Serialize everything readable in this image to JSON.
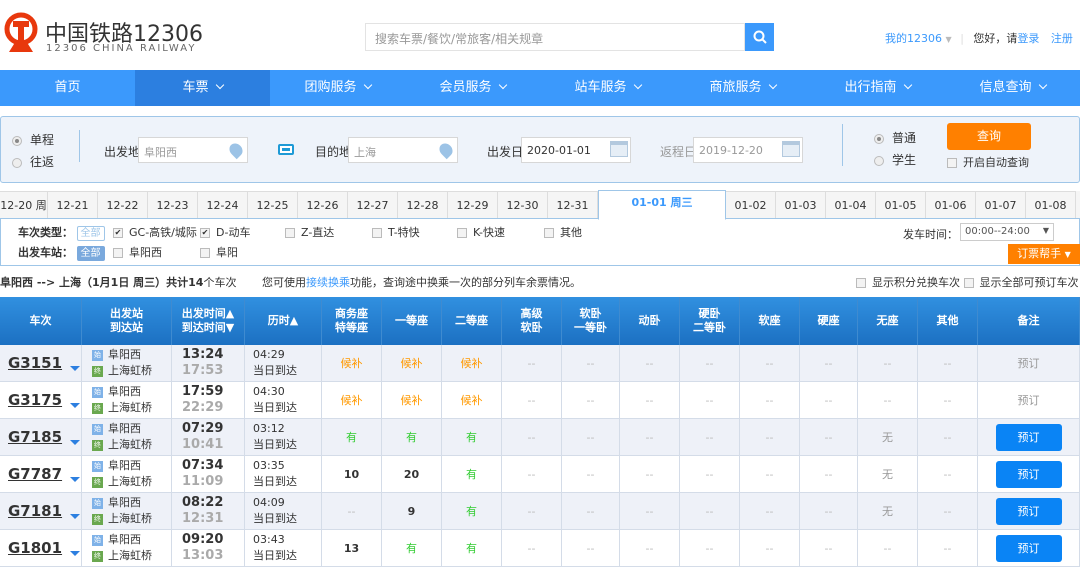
{
  "header": {
    "logo_cn": "中国铁路12306",
    "logo_en": "12306 CHINA RAILWAY",
    "search_placeholder": "搜索车票/餐饮/常旅客/相关规章",
    "my12306": "我的12306",
    "greeting": "您好，请",
    "login": "登录",
    "register": "注册"
  },
  "nav": [
    {
      "label": "首页"
    },
    {
      "label": "车票"
    },
    {
      "label": "团购服务"
    },
    {
      "label": "会员服务"
    },
    {
      "label": "站车服务"
    },
    {
      "label": "商旅服务"
    },
    {
      "label": "出行指南"
    },
    {
      "label": "信息查询"
    }
  ],
  "query": {
    "oneway": "单程",
    "roundtrip": "往返",
    "from_label": "出发地",
    "from_value": "阜阳西",
    "to_label": "目的地",
    "to_value": "上海",
    "date_label": "出发日",
    "date_value": "2020-01-01",
    "return_label": "返程日",
    "return_value": "2019-12-20",
    "normal": "普通",
    "student": "学生",
    "query_btn": "查询",
    "auto_query": "开启自动查询"
  },
  "dates": [
    "12-20 周",
    "12-21",
    "12-22",
    "12-23",
    "12-24",
    "12-25",
    "12-26",
    "12-27",
    "12-28",
    "12-29",
    "12-30",
    "12-31",
    "01-01 周三",
    "01-02",
    "01-03",
    "01-04",
    "01-05",
    "01-06",
    "01-07",
    "01-08"
  ],
  "filters": {
    "type_label": "车次类型：",
    "all": "全部",
    "types": [
      "GC-高铁/城际",
      "D-动车",
      "Z-直达",
      "T-特快",
      "K-快速",
      "其他"
    ],
    "station_label": "出发车站：",
    "stations": [
      "阜阳西",
      "阜阳"
    ],
    "time_label": "发车时间：",
    "time_value": "00:00--24:00",
    "helper": "订票帮手"
  },
  "summary": {
    "route": "阜阳西 --> 上海（1月1日  周三）共计",
    "count": "14",
    "suffix": "个车次",
    "tip_pre": "您可使用",
    "tip_link": "接续换乘",
    "tip_post": "功能，查询途中换乘一次的部分列车余票情况。",
    "opt1": "显示积分兑换车次",
    "opt2": "显示全部可预订车次"
  },
  "columns": [
    "车次",
    "出发站\n到达站",
    "出发时间▲\n到达时间▼",
    "历时▲",
    "商务座\n特等座",
    "一等座",
    "二等座",
    "高级\n软卧",
    "软卧\n一等卧",
    "动卧",
    "硬卧\n二等卧",
    "软座",
    "硬座",
    "无座",
    "其他",
    "备注"
  ],
  "station_icons": {
    "start": "始",
    "end": "终"
  },
  "rows": [
    {
      "no": "G3151",
      "from": "阜阳西",
      "to": "上海虹桥",
      "dep": "13:24",
      "arr": "17:53",
      "dur": "04:29",
      "day": "当日到达",
      "seats": [
        "候补",
        "候补",
        "候补",
        "--",
        "--",
        "--",
        "--",
        "--",
        "--",
        "--",
        "--"
      ],
      "remark": "预订",
      "bookable": false
    },
    {
      "no": "G3175",
      "from": "阜阳西",
      "to": "上海虹桥",
      "dep": "17:59",
      "arr": "22:29",
      "dur": "04:30",
      "day": "当日到达",
      "seats": [
        "候补",
        "候补",
        "候补",
        "--",
        "--",
        "--",
        "--",
        "--",
        "--",
        "--",
        "--"
      ],
      "remark": "预订",
      "bookable": false
    },
    {
      "no": "G7185",
      "from": "阜阳西",
      "to": "上海虹桥",
      "dep": "07:29",
      "arr": "10:41",
      "dur": "03:12",
      "day": "当日到达",
      "seats": [
        "有",
        "有",
        "有",
        "--",
        "--",
        "--",
        "--",
        "--",
        "--",
        "无",
        "--"
      ],
      "remark": "预订",
      "bookable": true
    },
    {
      "no": "G7787",
      "from": "阜阳西",
      "to": "上海虹桥",
      "dep": "07:34",
      "arr": "11:09",
      "dur": "03:35",
      "day": "当日到达",
      "seats": [
        "10",
        "20",
        "有",
        "--",
        "--",
        "--",
        "--",
        "--",
        "--",
        "无",
        "--"
      ],
      "remark": "预订",
      "bookable": true
    },
    {
      "no": "G7181",
      "from": "阜阳西",
      "to": "上海虹桥",
      "dep": "08:22",
      "arr": "12:31",
      "dur": "04:09",
      "day": "当日到达",
      "seats": [
        "--",
        "9",
        "有",
        "--",
        "--",
        "--",
        "--",
        "--",
        "--",
        "无",
        "--"
      ],
      "remark": "预订",
      "bookable": true
    },
    {
      "no": "G1801",
      "from": "阜阳西",
      "to": "上海虹桥",
      "dep": "09:20",
      "arr": "13:03",
      "dur": "03:43",
      "day": "当日到达",
      "seats": [
        "13",
        "有",
        "有",
        "--",
        "--",
        "--",
        "--",
        "--",
        "--",
        "--",
        "--"
      ],
      "remark": "预订",
      "bookable": true
    }
  ],
  "colors": {
    "brand": "#3b99fc",
    "accent": "#ff8000",
    "logo": "#e8380d"
  }
}
